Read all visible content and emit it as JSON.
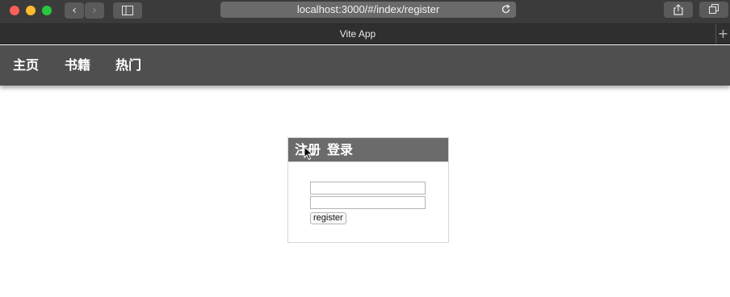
{
  "browser": {
    "url": "localhost:3000/#/index/register",
    "tab_title": "Vite App",
    "new_tab_symbol": "+",
    "back_symbol": "‹",
    "forward_symbol": "›"
  },
  "navbar": {
    "items": [
      {
        "label": "主页"
      },
      {
        "label": "书籍"
      },
      {
        "label": "热门"
      }
    ],
    "background": "#4f4f4f"
  },
  "auth_card": {
    "tabs": [
      {
        "label": "注册"
      },
      {
        "label": "登录"
      }
    ],
    "fields": [
      {
        "value": "",
        "placeholder": ""
      },
      {
        "value": "",
        "placeholder": ""
      }
    ],
    "submit_label": "register",
    "header_color": "#6b6b6b"
  },
  "icons": [
    "close-icon",
    "minimize-icon",
    "maximize-icon",
    "sidebar-icon",
    "reload-icon",
    "share-icon",
    "tabs-overview-icon",
    "mouse-cursor-icon"
  ]
}
